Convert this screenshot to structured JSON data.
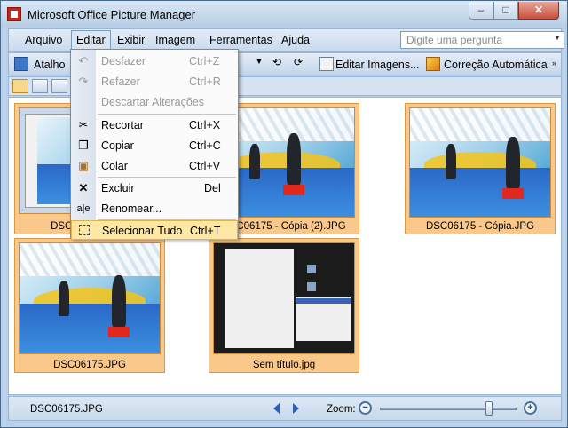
{
  "window": {
    "title": "Microsoft Office Picture Manager",
    "controls": {
      "minimize": "–",
      "maximize": "□",
      "close": "✕"
    }
  },
  "menubar": {
    "items": [
      {
        "label": "Arquivo"
      },
      {
        "label": "Editar"
      },
      {
        "label": "Exibir"
      },
      {
        "label": "Imagem"
      },
      {
        "label": "Ferramentas"
      },
      {
        "label": "Ajuda"
      }
    ],
    "active_menu": "Editar",
    "help_placeholder": "Digite uma pergunta"
  },
  "toolbar": {
    "shortcuts_label": "Atalho",
    "edit_images_label": "Editar Imagens...",
    "auto_correct_label": "Correção Automática"
  },
  "edit_menu": {
    "items": [
      {
        "label": "Desfazer",
        "shortcut": "Ctrl+Z",
        "icon": "undo-icon",
        "enabled": false
      },
      {
        "label": "Refazer",
        "shortcut": "Ctrl+R",
        "icon": "redo-icon",
        "enabled": false
      },
      {
        "label": "Descartar Alterações",
        "shortcut": "",
        "icon": "",
        "enabled": false
      },
      {
        "label": "Recortar",
        "shortcut": "Ctrl+X",
        "icon": "scissors-icon",
        "enabled": true
      },
      {
        "label": "Copiar",
        "shortcut": "Ctrl+C",
        "icon": "copy-icon",
        "enabled": true
      },
      {
        "label": "Colar",
        "shortcut": "Ctrl+V",
        "icon": "paste-icon",
        "enabled": true
      },
      {
        "label": "Excluir",
        "shortcut": "Del",
        "icon": "delete-icon",
        "enabled": true
      },
      {
        "label": "Renomear...",
        "shortcut": "",
        "icon": "rename-icon",
        "enabled": true
      },
      {
        "label": "Selecionar Tudo",
        "shortcut": "Ctrl+T",
        "icon": "select-all-icon",
        "enabled": true,
        "highlighted": true
      }
    ]
  },
  "thumbnails": [
    {
      "caption": "DSC06175.JPG",
      "kind": "screenshot"
    },
    {
      "caption": "DSC06175 - Cópia (2).JPG",
      "kind": "photo"
    },
    {
      "caption": "DSC06175 - Cópia.JPG",
      "kind": "photo"
    },
    {
      "caption": "DSC06175.JPG",
      "kind": "photo"
    },
    {
      "caption": "Sem título.jpg",
      "kind": "screenshot-dark"
    }
  ],
  "statusbar": {
    "filename": "DSC06175.JPG",
    "zoom_label": "Zoom:",
    "zoom_level": 0.82
  },
  "colors": {
    "selection": "#f9c88a",
    "menu_highlight": "#ffe8a6",
    "chrome": "#b9d1ea"
  }
}
